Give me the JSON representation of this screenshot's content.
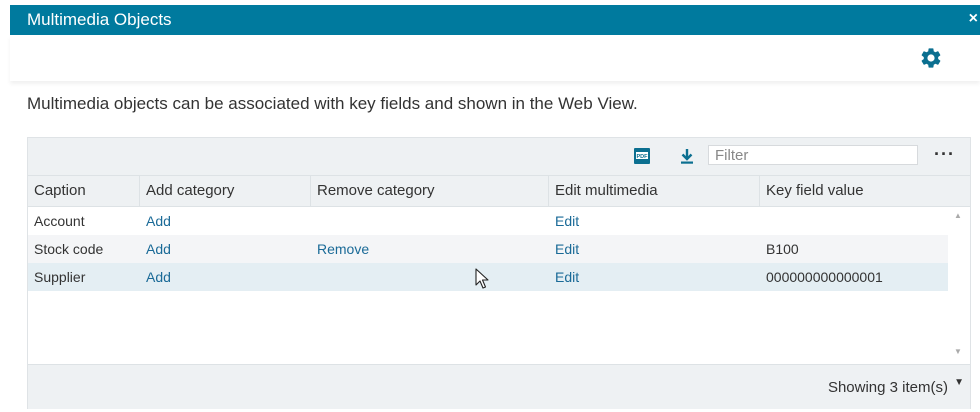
{
  "window": {
    "title": "Multimedia Objects",
    "close_label": "×"
  },
  "toolbar": {
    "settings_icon": "gear-icon"
  },
  "description": "Multimedia objects can be associated with key fields and shown in the Web View.",
  "grid": {
    "toolbar": {
      "pdf_icon": "pdf-icon",
      "download_icon": "download-icon",
      "filter_placeholder": "Filter",
      "filter_value": "",
      "more_label": "···"
    },
    "columns": [
      "Caption",
      "Add category",
      "Remove category",
      "Edit multimedia",
      "Key field value"
    ],
    "rows": [
      {
        "caption": "Account",
        "add": "Add",
        "remove": "",
        "edit": "Edit",
        "key": ""
      },
      {
        "caption": "Stock code",
        "add": "Add",
        "remove": "Remove",
        "edit": "Edit",
        "key": "B100"
      },
      {
        "caption": "Supplier",
        "add": "Add",
        "remove": "",
        "edit": "Edit",
        "key": "000000000000001"
      }
    ],
    "footer": {
      "count_text": "Showing 3 item(s)"
    }
  },
  "colors": {
    "title_bar": "#007a9e",
    "link": "#1a6a97",
    "gear": "#0b6f90",
    "grid_header": "#eef1f3"
  }
}
